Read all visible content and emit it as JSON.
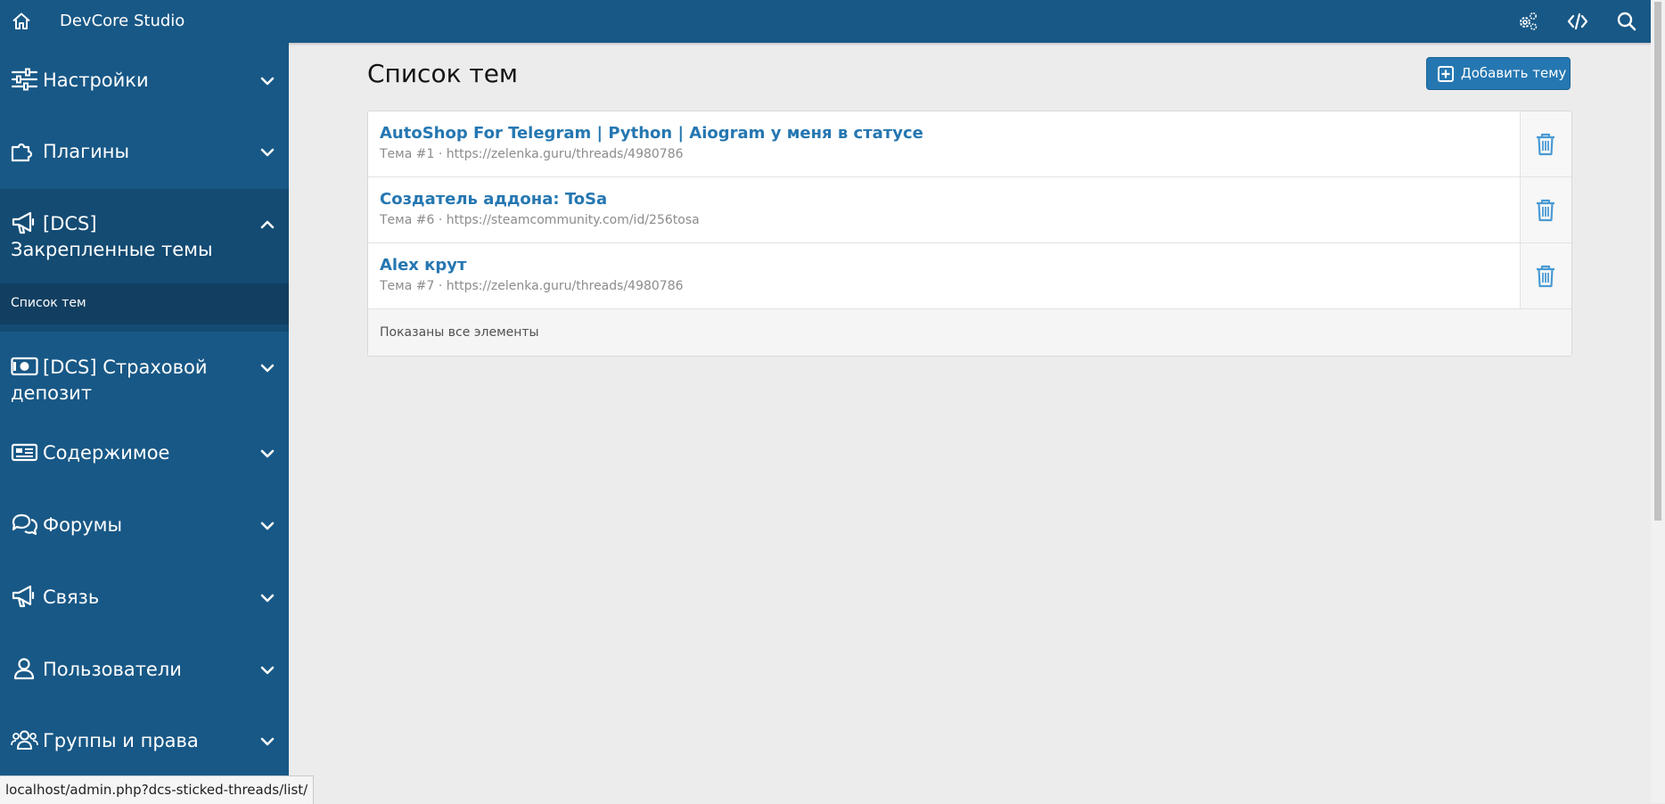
{
  "topbar": {
    "title": "DevCore Studio",
    "icons": [
      "home-icon",
      "cogs-icon",
      "code-icon",
      "search-icon"
    ]
  },
  "sidebar": {
    "sections": [
      {
        "label": "Настройки",
        "icon": "sliders-icon",
        "expanded": false
      },
      {
        "label": "Плагины",
        "icon": "puzzle-icon",
        "expanded": false
      },
      {
        "label": "[DCS] Закрепленные темы",
        "icon": "bullhorn-icon",
        "expanded": true,
        "subitems": [
          "Список тем"
        ]
      },
      {
        "label": "[DCS] Страховой депозит",
        "icon": "money-icon",
        "expanded": false
      },
      {
        "label": "Содержимое",
        "icon": "newspaper-icon",
        "expanded": false
      },
      {
        "label": "Форумы",
        "icon": "comments-icon",
        "expanded": false
      },
      {
        "label": "Связь",
        "icon": "bullhorn-icon",
        "expanded": false
      },
      {
        "label": "Пользователи",
        "icon": "user-icon",
        "expanded": false
      },
      {
        "label": "Группы и права",
        "icon": "users-icon",
        "expanded": false
      }
    ]
  },
  "main": {
    "title": "Список тем",
    "add_button": "Добавить тему",
    "items": [
      {
        "title": "AutoShop For Telegram | Python | Aiogram у меня в статусе",
        "meta": "Тема #1 · https://zelenka.guru/threads/4980786"
      },
      {
        "title": "Создатель аддона: ToSa",
        "meta": "Тема #6 · https://steamcommunity.com/id/256tosa"
      },
      {
        "title": "Alex крут",
        "meta": "Тема #7 · https://zelenka.guru/threads/4980786"
      }
    ],
    "footer": "Показаны все элементы"
  },
  "statusbar": {
    "url": "localhost/admin.php?dcs-sticked-threads/list/"
  },
  "colors": {
    "brand": "#185886",
    "link": "#2577b1",
    "delete": "#4a9ad4",
    "background": "#ececec"
  }
}
